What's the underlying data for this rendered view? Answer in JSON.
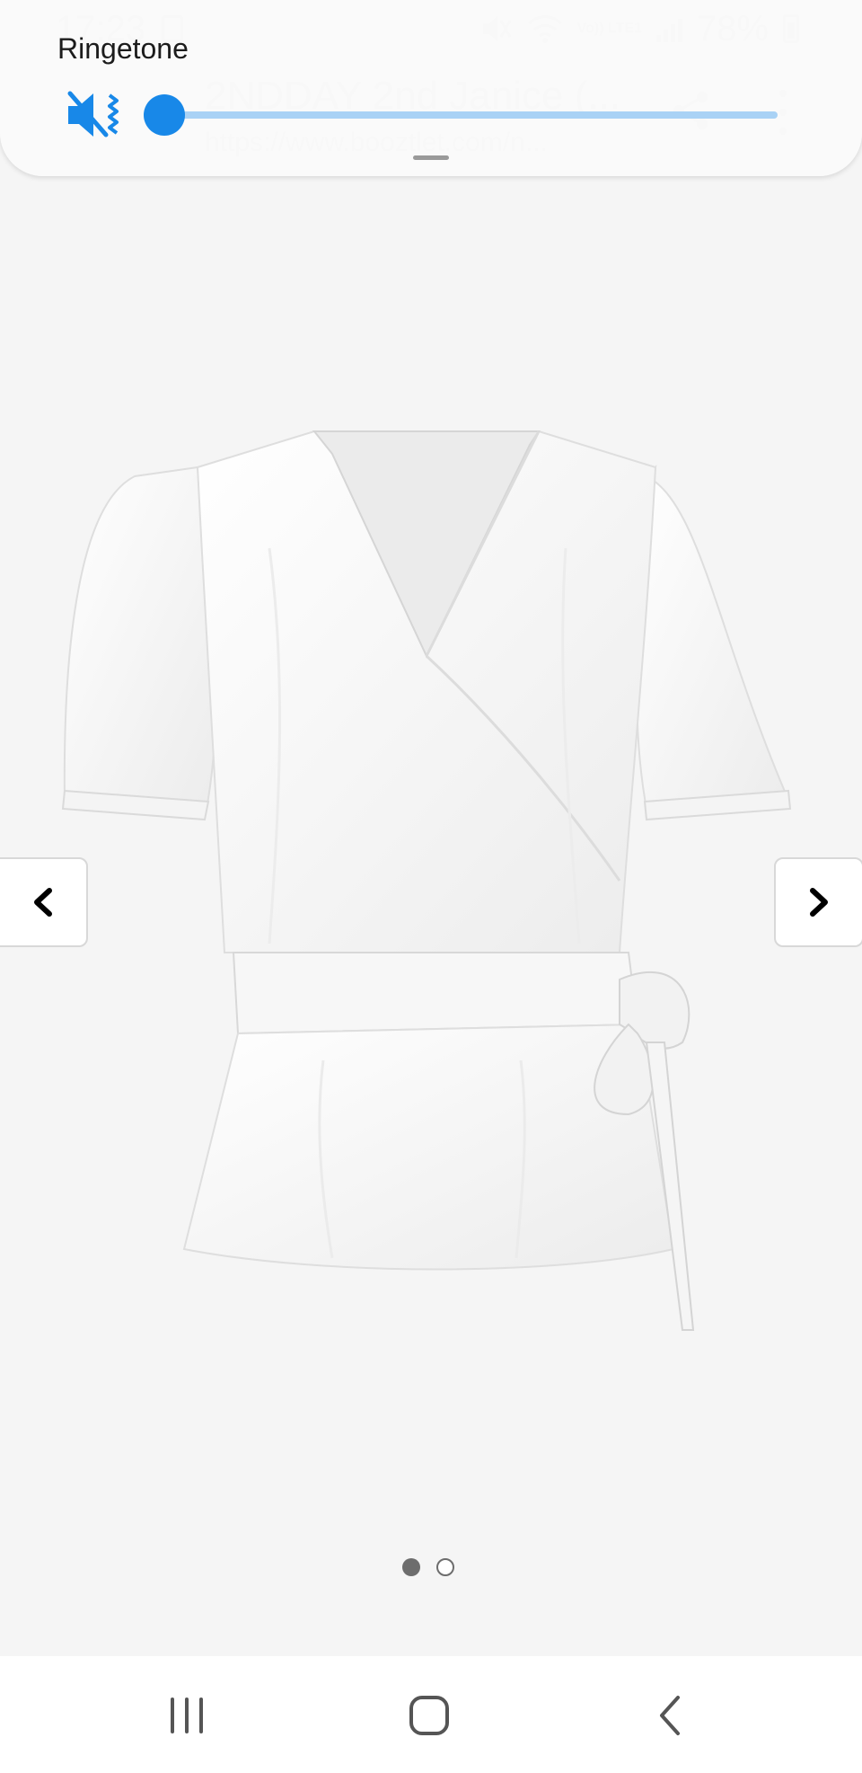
{
  "status_bar": {
    "time": "17:23",
    "network": "Vo)) LTE1",
    "battery": "78%"
  },
  "browser": {
    "page_title": "2NDDAY 2nd Janice (...",
    "page_url": "https://www.booztlet.com/n..."
  },
  "volume_panel": {
    "label": "Ringetone",
    "level": 0,
    "mode": "vibrate-mute",
    "accent_color": "#1888e8",
    "track_color": "#a9d2f5"
  },
  "gallery": {
    "image_name": "white wrap blouse with puff sleeves and tie belt",
    "current_index": 1,
    "total": 2
  },
  "icons": {
    "mute": "mute-vibrate-icon",
    "prev": "chevron-left-icon",
    "next": "chevron-right-icon",
    "recents": "recents-icon",
    "home": "home-icon",
    "back": "back-icon",
    "share": "share-icon",
    "more": "more-vertical-icon"
  }
}
